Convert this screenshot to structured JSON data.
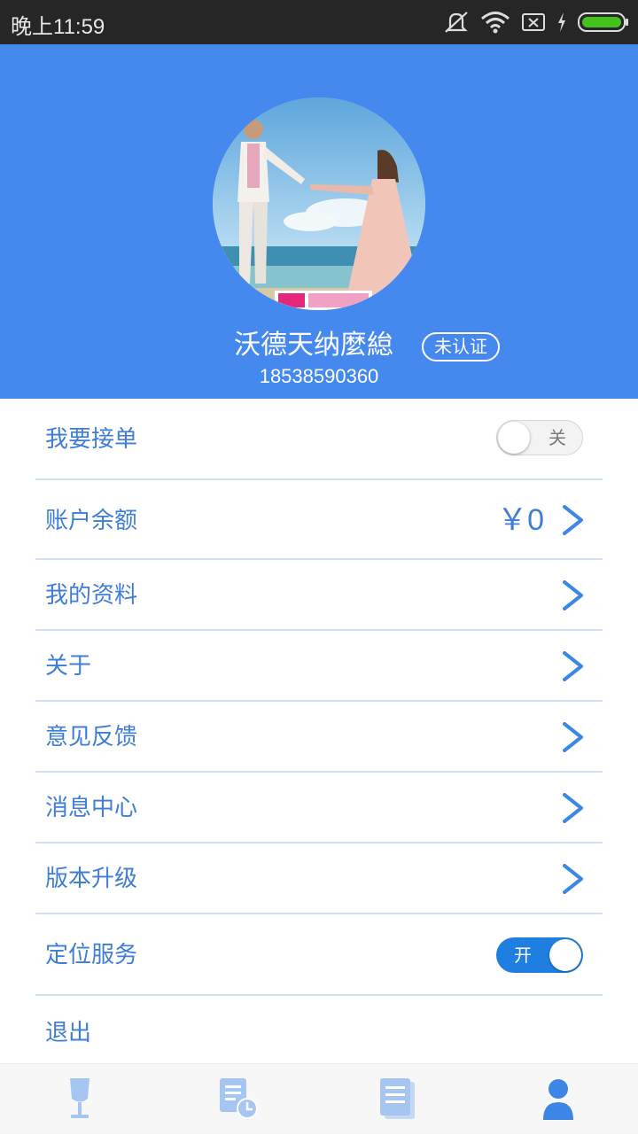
{
  "status_bar": {
    "time": "晚上11:59",
    "icons": [
      "mute-icon",
      "wifi-icon",
      "sim-off-icon",
      "charging-icon",
      "battery-icon"
    ]
  },
  "profile": {
    "name": "沃德天纳麼緿",
    "verify_status": "未认证",
    "phone": "18538590360",
    "avatar": "wedding-photo-avatar",
    "header_color": "#4589ee"
  },
  "menu": {
    "accept_orders": {
      "label": "我要接单",
      "toggle_text": "关",
      "enabled": false
    },
    "balance": {
      "label": "账户余额",
      "value": "￥0"
    },
    "my_profile": {
      "label": "我的资料"
    },
    "about": {
      "label": "关于"
    },
    "feedback": {
      "label": "意见反馈"
    },
    "messages": {
      "label": "消息中心"
    },
    "upgrade": {
      "label": "版本升级"
    },
    "location": {
      "label": "定位服务",
      "toggle_text": "开",
      "enabled": true
    },
    "logout": {
      "label": "退出"
    }
  },
  "bottom_nav": {
    "items": [
      {
        "icon": "wine-glass-icon",
        "active": false
      },
      {
        "icon": "order-history-icon",
        "active": false
      },
      {
        "icon": "documents-icon",
        "active": false
      },
      {
        "icon": "user-icon",
        "active": true
      }
    ],
    "active_color": "#3e86e5",
    "inactive_color": "#a6c6f2"
  }
}
